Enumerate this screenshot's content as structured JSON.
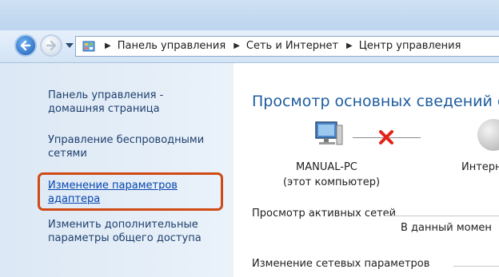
{
  "address_bar": {
    "crumbs": [
      "Панель управления",
      "Сеть и Интернет",
      "Центр управления"
    ]
  },
  "sidebar": {
    "items": [
      {
        "label": "Панель управления -",
        "label2": "домашняя страница"
      },
      {
        "label": "Управление беспроводными",
        "label2": "сетями"
      },
      {
        "label": "Изменение параметров",
        "label2": "адаптера"
      },
      {
        "label": "Изменить дополнительные",
        "label2": "параметры общего доступа"
      }
    ]
  },
  "main": {
    "title": "Просмотр основных сведений о",
    "computer_name": "MANUAL-PC",
    "computer_caption": "(этот компьютер)",
    "internet_label": "Интерн",
    "active_networks_label": "Просмотр активных сетей",
    "active_networks_status": "В данный момен",
    "change_settings_label": "Изменение сетевых параметров"
  },
  "colors": {
    "link": "#0645ad",
    "highlight": "#d04a14",
    "title": "#1e5c9f",
    "error_x": "#e2231a"
  }
}
